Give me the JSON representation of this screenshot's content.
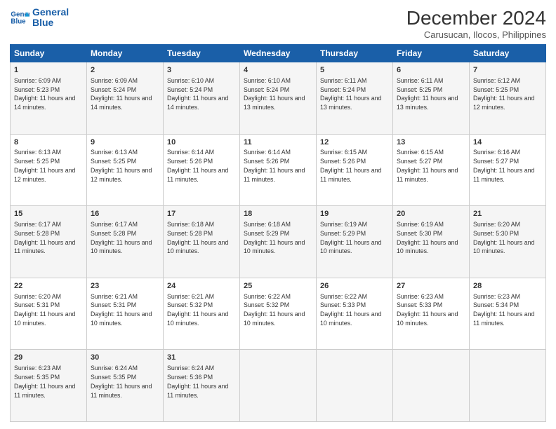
{
  "header": {
    "logo": {
      "line1": "General",
      "line2": "Blue"
    },
    "title": "December 2024",
    "subtitle": "Carusucan, Ilocos, Philippines"
  },
  "days_of_week": [
    "Sunday",
    "Monday",
    "Tuesday",
    "Wednesday",
    "Thursday",
    "Friday",
    "Saturday"
  ],
  "weeks": [
    [
      {
        "day": 1,
        "sunrise": "6:09 AM",
        "sunset": "5:23 PM",
        "daylight": "11 hours and 14 minutes."
      },
      {
        "day": 2,
        "sunrise": "6:09 AM",
        "sunset": "5:24 PM",
        "daylight": "11 hours and 14 minutes."
      },
      {
        "day": 3,
        "sunrise": "6:10 AM",
        "sunset": "5:24 PM",
        "daylight": "11 hours and 14 minutes."
      },
      {
        "day": 4,
        "sunrise": "6:10 AM",
        "sunset": "5:24 PM",
        "daylight": "11 hours and 13 minutes."
      },
      {
        "day": 5,
        "sunrise": "6:11 AM",
        "sunset": "5:24 PM",
        "daylight": "11 hours and 13 minutes."
      },
      {
        "day": 6,
        "sunrise": "6:11 AM",
        "sunset": "5:25 PM",
        "daylight": "11 hours and 13 minutes."
      },
      {
        "day": 7,
        "sunrise": "6:12 AM",
        "sunset": "5:25 PM",
        "daylight": "11 hours and 12 minutes."
      }
    ],
    [
      {
        "day": 8,
        "sunrise": "6:13 AM",
        "sunset": "5:25 PM",
        "daylight": "11 hours and 12 minutes."
      },
      {
        "day": 9,
        "sunrise": "6:13 AM",
        "sunset": "5:25 PM",
        "daylight": "11 hours and 12 minutes."
      },
      {
        "day": 10,
        "sunrise": "6:14 AM",
        "sunset": "5:26 PM",
        "daylight": "11 hours and 11 minutes."
      },
      {
        "day": 11,
        "sunrise": "6:14 AM",
        "sunset": "5:26 PM",
        "daylight": "11 hours and 11 minutes."
      },
      {
        "day": 12,
        "sunrise": "6:15 AM",
        "sunset": "5:26 PM",
        "daylight": "11 hours and 11 minutes."
      },
      {
        "day": 13,
        "sunrise": "6:15 AM",
        "sunset": "5:27 PM",
        "daylight": "11 hours and 11 minutes."
      },
      {
        "day": 14,
        "sunrise": "6:16 AM",
        "sunset": "5:27 PM",
        "daylight": "11 hours and 11 minutes."
      }
    ],
    [
      {
        "day": 15,
        "sunrise": "6:17 AM",
        "sunset": "5:28 PM",
        "daylight": "11 hours and 11 minutes."
      },
      {
        "day": 16,
        "sunrise": "6:17 AM",
        "sunset": "5:28 PM",
        "daylight": "11 hours and 10 minutes."
      },
      {
        "day": 17,
        "sunrise": "6:18 AM",
        "sunset": "5:28 PM",
        "daylight": "11 hours and 10 minutes."
      },
      {
        "day": 18,
        "sunrise": "6:18 AM",
        "sunset": "5:29 PM",
        "daylight": "11 hours and 10 minutes."
      },
      {
        "day": 19,
        "sunrise": "6:19 AM",
        "sunset": "5:29 PM",
        "daylight": "11 hours and 10 minutes."
      },
      {
        "day": 20,
        "sunrise": "6:19 AM",
        "sunset": "5:30 PM",
        "daylight": "11 hours and 10 minutes."
      },
      {
        "day": 21,
        "sunrise": "6:20 AM",
        "sunset": "5:30 PM",
        "daylight": "11 hours and 10 minutes."
      }
    ],
    [
      {
        "day": 22,
        "sunrise": "6:20 AM",
        "sunset": "5:31 PM",
        "daylight": "11 hours and 10 minutes."
      },
      {
        "day": 23,
        "sunrise": "6:21 AM",
        "sunset": "5:31 PM",
        "daylight": "11 hours and 10 minutes."
      },
      {
        "day": 24,
        "sunrise": "6:21 AM",
        "sunset": "5:32 PM",
        "daylight": "11 hours and 10 minutes."
      },
      {
        "day": 25,
        "sunrise": "6:22 AM",
        "sunset": "5:32 PM",
        "daylight": "11 hours and 10 minutes."
      },
      {
        "day": 26,
        "sunrise": "6:22 AM",
        "sunset": "5:33 PM",
        "daylight": "11 hours and 10 minutes."
      },
      {
        "day": 27,
        "sunrise": "6:23 AM",
        "sunset": "5:33 PM",
        "daylight": "11 hours and 10 minutes."
      },
      {
        "day": 28,
        "sunrise": "6:23 AM",
        "sunset": "5:34 PM",
        "daylight": "11 hours and 11 minutes."
      }
    ],
    [
      {
        "day": 29,
        "sunrise": "6:23 AM",
        "sunset": "5:35 PM",
        "daylight": "11 hours and 11 minutes."
      },
      {
        "day": 30,
        "sunrise": "6:24 AM",
        "sunset": "5:35 PM",
        "daylight": "11 hours and 11 minutes."
      },
      {
        "day": 31,
        "sunrise": "6:24 AM",
        "sunset": "5:36 PM",
        "daylight": "11 hours and 11 minutes."
      },
      null,
      null,
      null,
      null
    ]
  ]
}
